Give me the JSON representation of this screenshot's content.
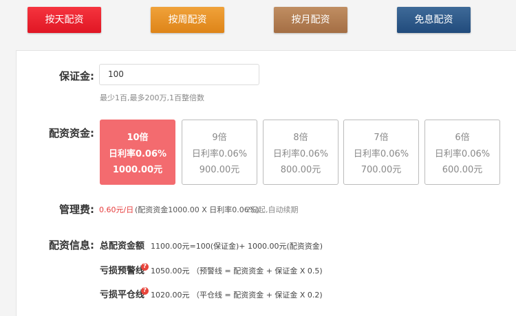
{
  "tabs": [
    {
      "label": "按天配资",
      "color": "#e8202b"
    },
    {
      "label": "按周配资",
      "color": "#e38f25"
    },
    {
      "label": "按月配资",
      "color": "#b07b52"
    },
    {
      "label": "免息配资",
      "color": "#2c588a"
    }
  ],
  "form": {
    "deposit_label": "保证金:",
    "deposit_value": "100",
    "deposit_hint": "最少1百,最多200万,1百整倍数",
    "funding_label": "配资资金:",
    "options": [
      {
        "multiple": "10倍",
        "rate": "日利率0.06%",
        "amount": "1000.00元",
        "selected": true
      },
      {
        "multiple": "9倍",
        "rate": "日利率0.06%",
        "amount": "900.00元",
        "selected": false
      },
      {
        "multiple": "8倍",
        "rate": "日利率0.06%",
        "amount": "800.00元",
        "selected": false
      },
      {
        "multiple": "7倍",
        "rate": "日利率0.06%",
        "amount": "700.00元",
        "selected": false
      },
      {
        "multiple": "6倍",
        "rate": "日利率0.06%",
        "amount": "600.00元",
        "selected": false
      }
    ],
    "fee_label": "管理费:",
    "fee_amount": "0.60元/日",
    "fee_formula": "(配资资金1000.00 X 日利率0.06%)",
    "fee_note": "2日起,自动续期",
    "info_label": "配资信息:",
    "info": {
      "total_key": "总配资金额",
      "total_value": "1100.00元=100(保证金)+ 1000.00元(配资资金)",
      "warning_key": "亏损预警线",
      "warning_value": "1050.00元 （预警线 = 配资资金 + 保证金 X 0.5)",
      "stop_key": "亏损平仓线",
      "stop_value": "1020.00元 （平仓线 = 配资资金 + 保证金 X 0.2)",
      "help_glyph": "?"
    }
  },
  "colors": {
    "selected_option_bg": "#f36b6f",
    "fee_amount": "#e63c3c",
    "help_icon": "#e8453c"
  }
}
